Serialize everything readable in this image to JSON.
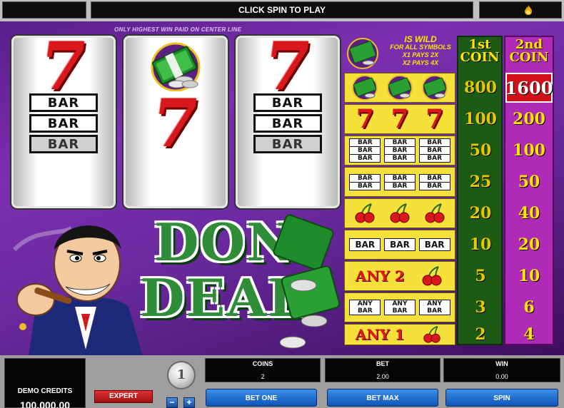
{
  "top_bar": {
    "message": "CLICK SPIN TO PLAY"
  },
  "reels": {
    "center_line_note": "ONLY HIGHEST WIN PAID ON CENTER LINE",
    "reel_1": [
      "seven",
      "bar-triple",
      ""
    ],
    "reel_2": [
      "money",
      "seven",
      ""
    ],
    "reel_3": [
      "seven",
      "bar-triple",
      ""
    ],
    "bar_text": "BAR"
  },
  "logo": {
    "line1": "DON",
    "line2": "DEAL"
  },
  "paytable": {
    "wild_title": "IS WILD",
    "wild_subtitle": "FOR ALL SYMBOLS",
    "wild_x1": "X1 PAYS 2X",
    "wild_x2": "X2 PAYS 4X",
    "col1_line1": "1st",
    "col1_line2": "COIN",
    "col2_line1": "2nd",
    "col2_line2": "COIN",
    "any2_label": "ANY 2",
    "any1_label": "ANY 1",
    "any_bar_line1": "ANY",
    "any_bar_line2": "BAR",
    "rows": [
      {
        "combo": "money x3",
        "coin1": "800",
        "coin2": "1600"
      },
      {
        "combo": "seven x3",
        "coin1": "100",
        "coin2": "200"
      },
      {
        "combo": "triple bar x3",
        "coin1": "50",
        "coin2": "100"
      },
      {
        "combo": "double bar x3",
        "coin1": "25",
        "coin2": "50"
      },
      {
        "combo": "cherry x3",
        "coin1": "20",
        "coin2": "40"
      },
      {
        "combo": "single bar x3",
        "coin1": "10",
        "coin2": "20"
      },
      {
        "combo": "any 2 cherry",
        "coin1": "5",
        "coin2": "10"
      },
      {
        "combo": "any bar x3",
        "coin1": "3",
        "coin2": "6"
      },
      {
        "combo": "any 1 cherry",
        "coin1": "2",
        "coin2": "4"
      }
    ]
  },
  "controls": {
    "credits_label": "DEMO CREDITS",
    "credits_value": "100,000.00",
    "expert_label": "EXPERT",
    "coin_value": "1",
    "coin_minus": "−",
    "coin_plus": "+",
    "coins_label": "COINS",
    "coins_value": "2",
    "bet_label": "BET",
    "bet_value": "2.00",
    "win_label": "WIN",
    "win_value": "0.00",
    "bet_one_label": "BET ONE",
    "bet_max_label": "BET MAX",
    "spin_label": "SPIN"
  },
  "icons": {
    "top_right": "flame-icon",
    "wild_symbol": "money-stack-icon",
    "cherry": "cherry-icon"
  },
  "colors": {
    "background": "#7c2fb0",
    "paytable_yellow": "#f5e13a",
    "col1_green": "#1d5a16",
    "col2_purple": "#b02ab8",
    "highlight_red": "#d2101a",
    "button_blue": "#1f6fd0"
  }
}
